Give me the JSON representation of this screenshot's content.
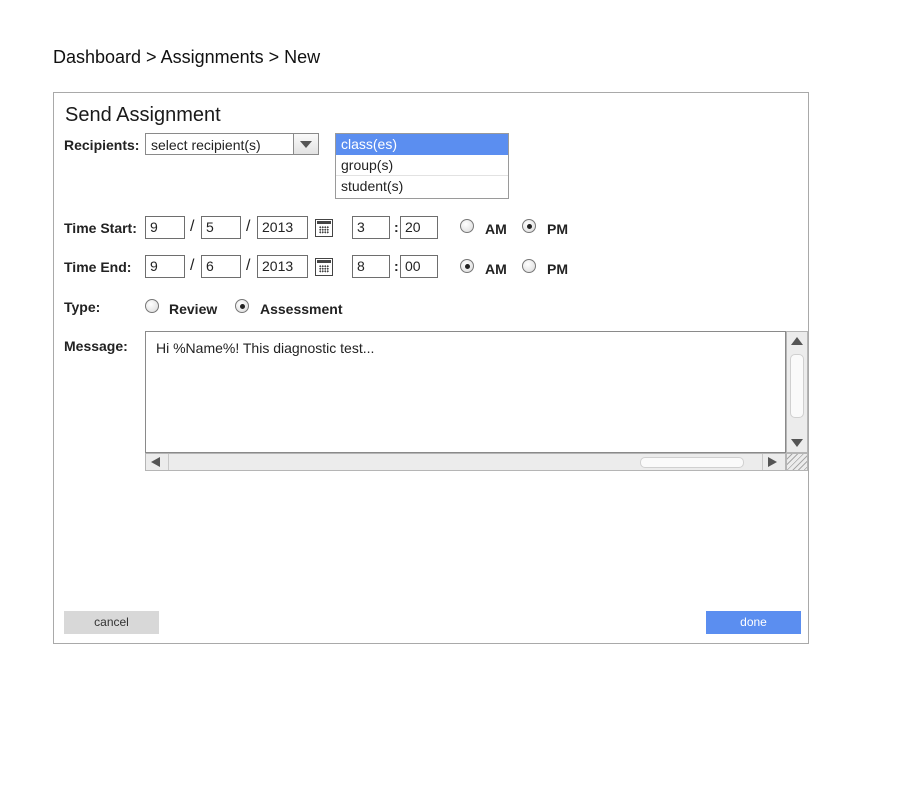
{
  "breadcrumb": {
    "text": "Dashboard > Assignments > New"
  },
  "dialog": {
    "title": "Send Assignment"
  },
  "recipients": {
    "label": "Recipients:",
    "select_value": "select recipient(s)",
    "options": [
      {
        "label": "class(es)",
        "selected": true
      },
      {
        "label": "group(s)",
        "selected": false
      },
      {
        "label": "student(s)",
        "selected": false
      }
    ]
  },
  "time_start": {
    "label": "Time Start:",
    "month": "9",
    "day": "5",
    "year": "2013",
    "hour": "3",
    "minute": "20",
    "am_label": "AM",
    "pm_label": "PM",
    "selected": "PM"
  },
  "time_end": {
    "label": "Time End:",
    "month": "9",
    "day": "6",
    "year": "2013",
    "hour": "8",
    "minute": "00",
    "am_label": "AM",
    "pm_label": "PM",
    "selected": "AM"
  },
  "separators": {
    "slash": "/",
    "colon": ":"
  },
  "type": {
    "label": "Type:",
    "options": [
      "Review",
      "Assessment"
    ],
    "selected": "Assessment"
  },
  "message": {
    "label": "Message:",
    "text": "Hi %Name%! This diagnostic test..."
  },
  "buttons": {
    "cancel": "cancel",
    "done": "done"
  },
  "colors": {
    "accent": "#5b8ef0",
    "cancel_bg": "#d8d8d8"
  },
  "icons": {
    "calendar": "calendar-icon",
    "dropdown": "chevron-down-icon"
  }
}
